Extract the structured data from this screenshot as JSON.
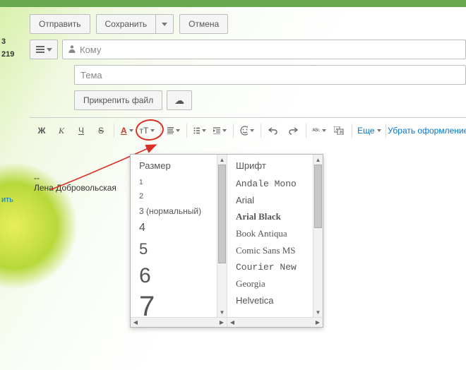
{
  "top_buttons": {
    "send": "Отправить",
    "save": "Сохранить",
    "cancel": "Отмена"
  },
  "left_sidebar": {
    "count_small": "3",
    "count_big": "219",
    "reply_edit": "ить"
  },
  "compose": {
    "to_placeholder": "Кому",
    "subject_placeholder": "Тема",
    "attach": "Прикрепить файл",
    "more": "Еще",
    "remove_formatting": "Убрать оформление"
  },
  "format": {
    "bold": "Ж",
    "italic": "К",
    "underline": "Ч",
    "strike": "S",
    "color": "A",
    "size": "тТ",
    "abc": "ᴬᴮᶜ"
  },
  "signature_sep": "--",
  "signature": "Лена Добровольская",
  "dropdown": {
    "size_header": "Размер",
    "font_header": "Шрифт",
    "sizes": [
      "1",
      "2",
      "3 (нормальный)",
      "4",
      "5",
      "6",
      "7"
    ],
    "fonts": [
      "Andale Mono",
      "Arial",
      "Arial Black",
      "Book Antiqua",
      "Comic Sans MS",
      "Courier New",
      "Georgia",
      "Helvetica"
    ]
  }
}
